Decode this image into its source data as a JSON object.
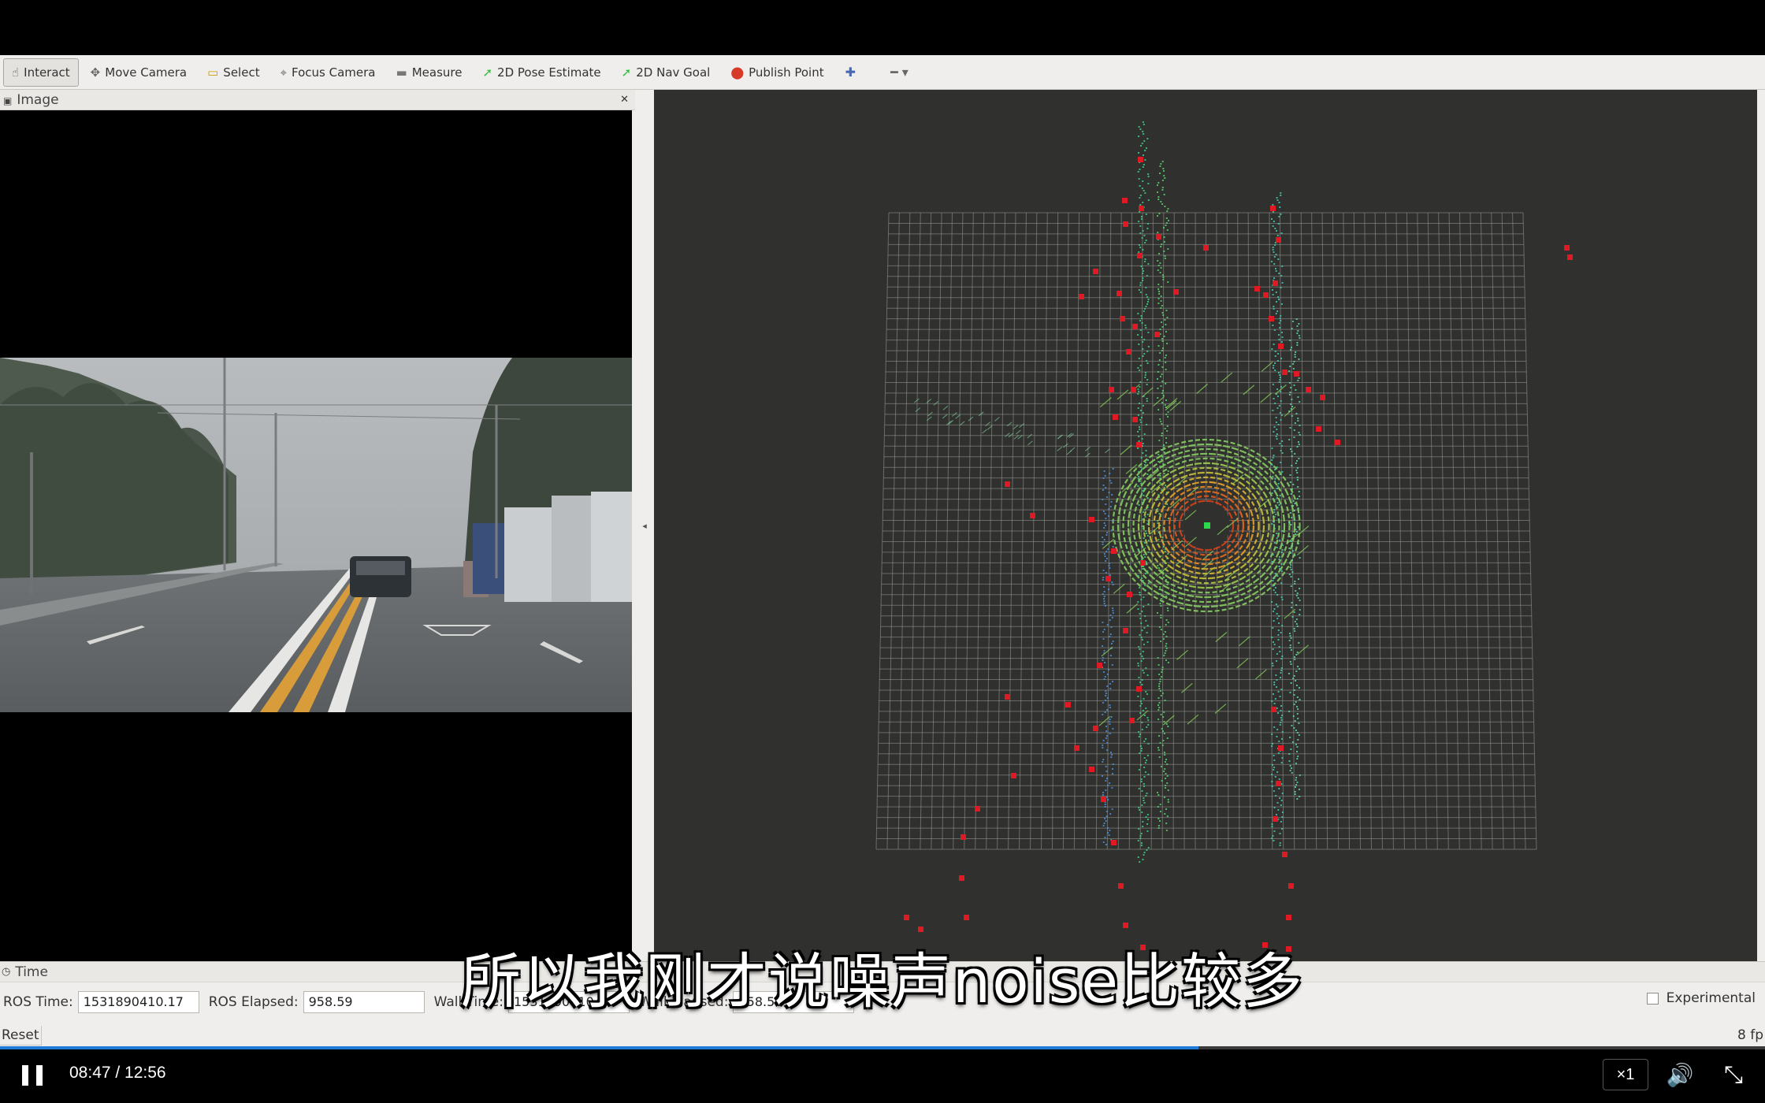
{
  "toolbar": {
    "tools": [
      {
        "label": "Interact",
        "icon": "hand-pointer-icon",
        "glyph": "☝",
        "color": "#555555"
      },
      {
        "label": "Move Camera",
        "icon": "move-arrows-icon",
        "glyph": "✥",
        "color": "#666666"
      },
      {
        "label": "Select",
        "icon": "selection-box-icon",
        "glyph": "▭",
        "color": "#c8a000"
      },
      {
        "label": "Focus Camera",
        "icon": "crosshair-icon",
        "glyph": "⌖",
        "color": "#666666"
      },
      {
        "label": "Measure",
        "icon": "ruler-icon",
        "glyph": "▬",
        "color": "#777777"
      },
      {
        "label": "2D Pose Estimate",
        "icon": "green-arrow-icon",
        "glyph": "➚",
        "color": "#2fbf3a"
      },
      {
        "label": "2D Nav Goal",
        "icon": "green-arrow-icon",
        "glyph": "➚",
        "color": "#2fbf3a"
      },
      {
        "label": "Publish Point",
        "icon": "map-pin-icon",
        "glyph": "⬤",
        "color": "#d83a2a"
      }
    ],
    "add_icon": "✚",
    "remove_icon": "━ ▾"
  },
  "image_panel": {
    "title": "Image",
    "close": "✕"
  },
  "time_panel": {
    "title": "Time",
    "ros_time_label": "ROS Time:",
    "ros_time_value": "1531890410.17",
    "ros_elapsed_label": "ROS Elapsed:",
    "ros_elapsed_value": "958.59",
    "wall_time_label": "Wall Time:",
    "wall_time_value": "1531890410.30",
    "wall_elapsed_label": "Wall Elapsed:",
    "wall_elapsed_value": "958.56",
    "experimental_label": "Experimental",
    "experimental_checked": false,
    "reset_label": "Reset",
    "fps_label": "8 fp"
  },
  "subtitle": "所以我刚才说噪声noise比较多",
  "player": {
    "timecode": "08:47 / 12:56",
    "progress_fraction": 0.679,
    "speed_label": "×1",
    "volume_glyph": "🔊",
    "fullscreen_glyph": "⤡",
    "accent": "#1f7ad8"
  }
}
